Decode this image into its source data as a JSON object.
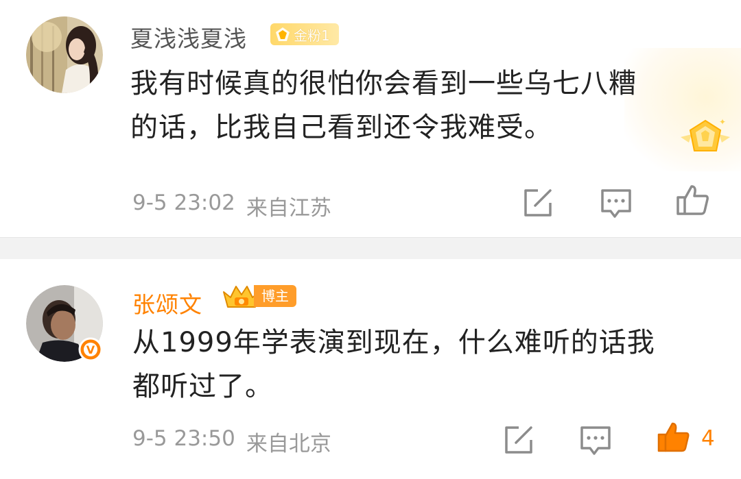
{
  "comments": [
    {
      "user": "夏浅浅夏浅",
      "badge": "金粉1",
      "lines": [
        "我有时候真的很怕你会看到一些乌七八糟",
        "的话，比我自己看到还令我难受。"
      ],
      "date": "9-5 23:02",
      "location": "来自江苏",
      "likes": "",
      "name_color": "#555555",
      "like_color": "#888888"
    },
    {
      "user": "张颂文",
      "badge": "博主",
      "lines": [
        "从1999年学表演到现在，什么难听的话我",
        "都听过了。"
      ],
      "date": "9-5 23:50",
      "location": "来自北京",
      "likes": "4",
      "name_color": "#ff8200",
      "like_color": "#ff8200",
      "verified": "V"
    }
  ],
  "icons": {
    "repost": "edit-square-icon",
    "reply": "comment-bubble-icon",
    "like": "thumbs-up-icon"
  },
  "colors": {
    "accent": "#ff8200",
    "gray_text": "#999999",
    "divider": "#f2f2f2"
  }
}
